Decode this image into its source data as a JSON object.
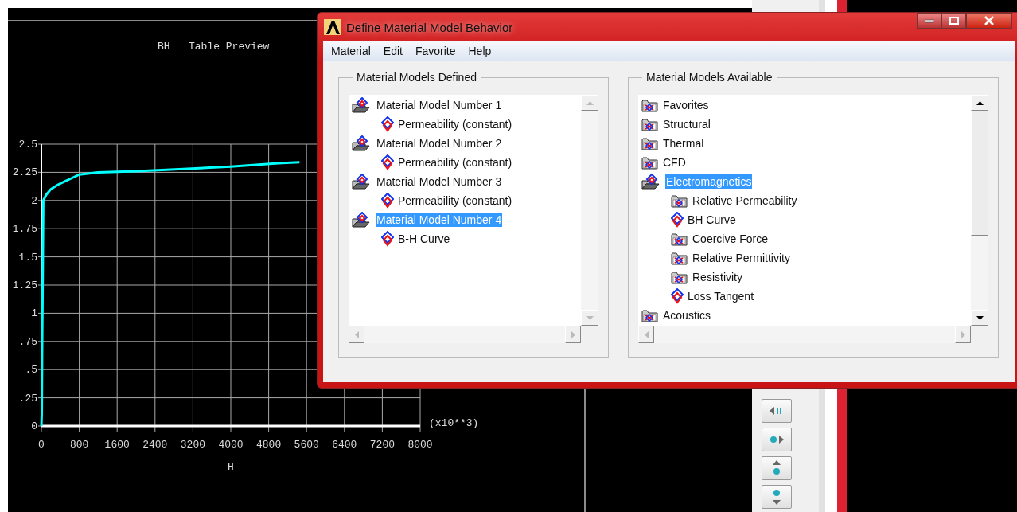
{
  "graphics": {
    "chart_data": {
      "type": "line",
      "title": "BH   Table Preview",
      "xlabel": "H",
      "x": [
        0,
        8,
        15,
        25,
        40,
        100,
        200,
        350,
        500,
        650,
        800,
        1200,
        2000,
        3000,
        4000,
        5000,
        5450
      ],
      "series": [
        {
          "color": "#00ffff",
          "values": [
            0,
            0.1,
            0.65,
            1.15,
            2.0,
            2.05,
            2.1,
            2.14,
            2.17,
            2.2,
            2.23,
            2.25,
            2.26,
            2.28,
            2.3,
            2.33,
            2.34
          ]
        }
      ],
      "grid": true,
      "xlim": [
        0,
        8000
      ],
      "ylim": [
        0,
        2.5
      ],
      "xticks": [
        0,
        800,
        1600,
        2400,
        3200,
        4000,
        4800,
        5600,
        6400,
        7200,
        8000
      ],
      "yticks": [
        {
          "value": 0,
          "label": "0"
        },
        {
          "value": 0.25,
          "label": ".25"
        },
        {
          "value": 0.5,
          "label": ".5"
        },
        {
          "value": 0.75,
          "label": ".75"
        },
        {
          "value": 1,
          "label": "1"
        },
        {
          "value": 1.25,
          "label": "1.25"
        },
        {
          "value": 1.5,
          "label": "1.5"
        },
        {
          "value": 1.75,
          "label": "1.75"
        },
        {
          "value": 2,
          "label": "2"
        },
        {
          "value": 2.25,
          "label": "2.25"
        },
        {
          "value": 2.5,
          "label": "2.5"
        }
      ],
      "annotations": [
        "(x10**3)"
      ]
    }
  },
  "dialog": {
    "title": "Define Material Model Behavior",
    "menu": [
      "Material",
      "Edit",
      "Favorite",
      "Help"
    ],
    "panels": [
      {
        "title": "Material Models Defined",
        "items": [
          {
            "label": "Material Model Number 1",
            "kind": "folder",
            "expanded": true,
            "selected": false,
            "children": [
              {
                "label": "Permeability (constant)",
                "kind": "leaf",
                "selected": false
              }
            ]
          },
          {
            "label": "Material Model Number 2",
            "kind": "folder",
            "expanded": true,
            "selected": false,
            "children": [
              {
                "label": "Permeability (constant)",
                "kind": "leaf",
                "selected": false
              }
            ]
          },
          {
            "label": "Material Model Number 3",
            "kind": "folder",
            "expanded": true,
            "selected": false,
            "children": [
              {
                "label": "Permeability (constant)",
                "kind": "leaf",
                "selected": false
              }
            ]
          },
          {
            "label": "Material Model Number 4",
            "kind": "folder",
            "expanded": true,
            "selected": true,
            "children": [
              {
                "label": "B-H Curve",
                "kind": "leaf",
                "selected": false
              }
            ]
          }
        ]
      },
      {
        "title": "Material Models Available",
        "items": [
          {
            "label": "Favorites",
            "kind": "folder",
            "expanded": false,
            "selected": false
          },
          {
            "label": "Structural",
            "kind": "folder",
            "expanded": false,
            "selected": false
          },
          {
            "label": "Thermal",
            "kind": "folder",
            "expanded": false,
            "selected": false
          },
          {
            "label": "CFD",
            "kind": "folder",
            "expanded": false,
            "selected": false
          },
          {
            "label": "Electromagnetics",
            "kind": "folder",
            "expanded": true,
            "selected": true,
            "children": [
              {
                "label": "Relative Permeability",
                "kind": "folder",
                "expanded": false,
                "selected": false
              },
              {
                "label": "BH Curve",
                "kind": "leaf",
                "selected": false
              },
              {
                "label": "Coercive Force",
                "kind": "folder",
                "expanded": false,
                "selected": false
              },
              {
                "label": "Relative Permittivity",
                "kind": "folder",
                "expanded": false,
                "selected": false
              },
              {
                "label": "Resistivity",
                "kind": "folder",
                "expanded": false,
                "selected": false
              },
              {
                "label": "Loss Tangent",
                "kind": "leaf",
                "selected": false
              }
            ]
          },
          {
            "label": "Acoustics",
            "kind": "folder",
            "expanded": false,
            "selected": false
          }
        ]
      }
    ]
  }
}
